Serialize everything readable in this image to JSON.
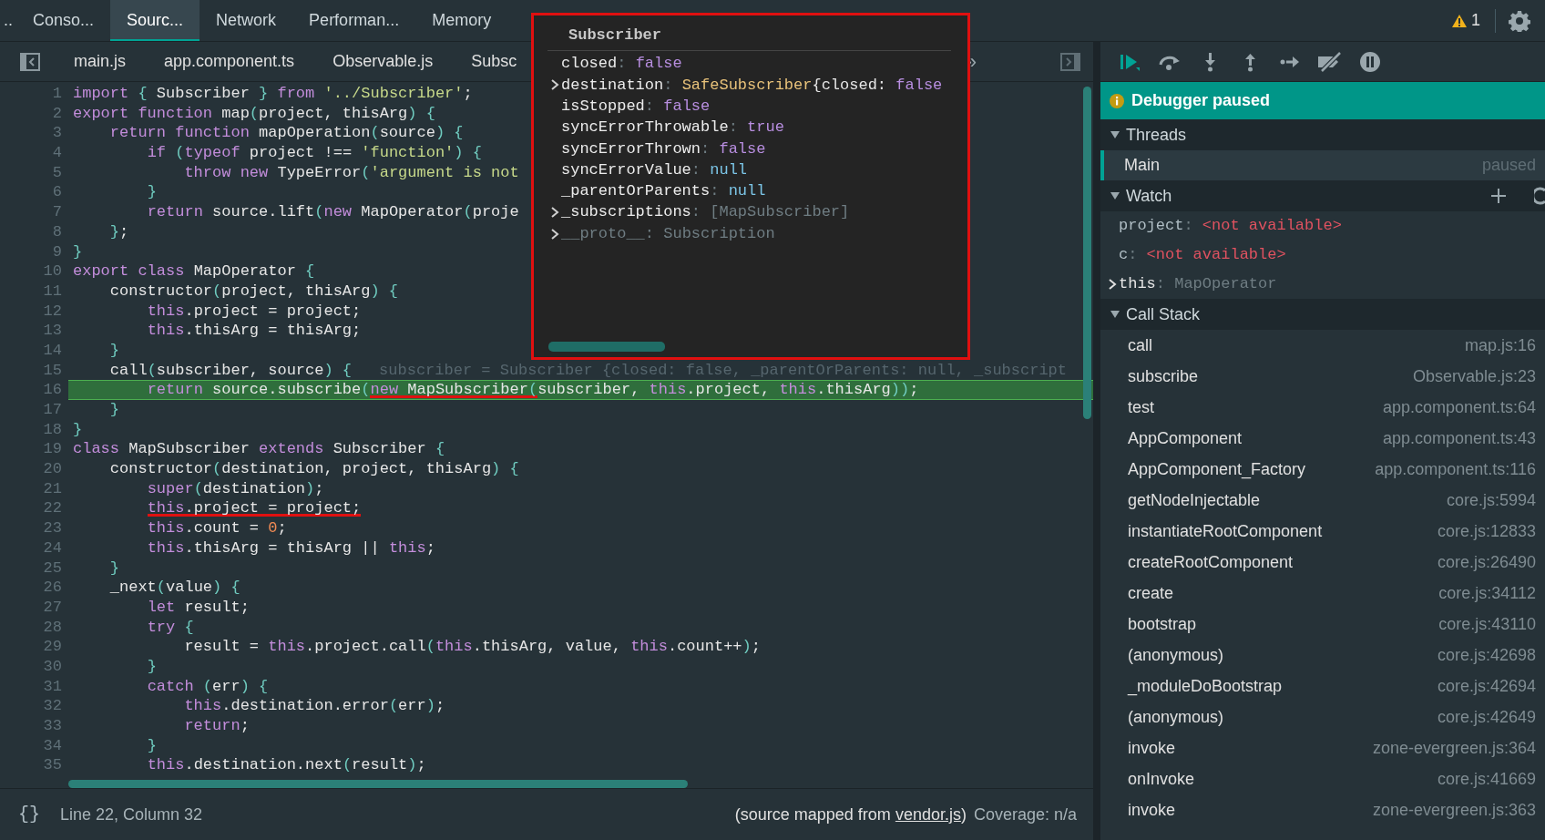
{
  "top_tabs": [
    {
      "label": "..",
      "selected": false
    },
    {
      "label": "Conso...",
      "selected": false
    },
    {
      "label": "Sourc...",
      "selected": true
    },
    {
      "label": "Network",
      "selected": false
    },
    {
      "label": "Performan...",
      "selected": false
    },
    {
      "label": "Memory",
      "selected": false
    }
  ],
  "warnings": "1",
  "file_tabs": [
    {
      "label": "main.js"
    },
    {
      "label": "app.component.ts"
    },
    {
      "label": "Observable.js"
    },
    {
      "label": "Subsc"
    }
  ],
  "file_tabs_more": "»",
  "code": {
    "lines": [
      {
        "number": "1",
        "current": false,
        "tokens": [
          {
            "kind": "keyword",
            "text": "import "
          },
          {
            "kind": "punct",
            "text": "{"
          },
          {
            "kind": "plain",
            "text": " Subscriber "
          },
          {
            "kind": "punct",
            "text": "}"
          },
          {
            "kind": "keyword",
            "text": " from "
          },
          {
            "kind": "string",
            "text": "'../Subscriber'"
          },
          {
            "kind": "plain",
            "text": ";"
          }
        ]
      },
      {
        "number": "2",
        "current": false,
        "tokens": [
          {
            "kind": "keyword",
            "text": "export function "
          },
          {
            "kind": "plain",
            "text": "map"
          },
          {
            "kind": "punct",
            "text": "("
          },
          {
            "kind": "plain",
            "text": "project, thisArg"
          },
          {
            "kind": "punct",
            "text": ") {"
          }
        ]
      },
      {
        "number": "3",
        "current": false,
        "tokens": [
          {
            "kind": "keyword",
            "text": "    return function "
          },
          {
            "kind": "plain",
            "text": "mapOperation"
          },
          {
            "kind": "punct",
            "text": "("
          },
          {
            "kind": "plain",
            "text": "source"
          },
          {
            "kind": "punct",
            "text": ") {"
          }
        ]
      },
      {
        "number": "4",
        "current": false,
        "tokens": [
          {
            "kind": "keyword",
            "text": "        if "
          },
          {
            "kind": "punct",
            "text": "("
          },
          {
            "kind": "keyword",
            "text": "typeof "
          },
          {
            "kind": "plain",
            "text": "project !== "
          },
          {
            "kind": "string",
            "text": "'function'"
          },
          {
            "kind": "punct",
            "text": ") {"
          }
        ]
      },
      {
        "number": "5",
        "current": false,
        "tokens": [
          {
            "kind": "keyword",
            "text": "            throw new "
          },
          {
            "kind": "plain",
            "text": "TypeError"
          },
          {
            "kind": "punct",
            "text": "("
          },
          {
            "kind": "string",
            "text": "'argument is not"
          }
        ]
      },
      {
        "number": "6",
        "current": false,
        "tokens": [
          {
            "kind": "punct",
            "text": "        }"
          }
        ]
      },
      {
        "number": "7",
        "current": false,
        "tokens": [
          {
            "kind": "keyword",
            "text": "        return "
          },
          {
            "kind": "plain",
            "text": "source.lift"
          },
          {
            "kind": "punct",
            "text": "("
          },
          {
            "kind": "keyword",
            "text": "new "
          },
          {
            "kind": "plain",
            "text": "MapOperator"
          },
          {
            "kind": "punct",
            "text": "("
          },
          {
            "kind": "plain",
            "text": "proje"
          }
        ]
      },
      {
        "number": "8",
        "current": false,
        "tokens": [
          {
            "kind": "punct",
            "text": "    }"
          },
          {
            "kind": "plain",
            "text": ";"
          }
        ]
      },
      {
        "number": "9",
        "current": false,
        "tokens": [
          {
            "kind": "punct",
            "text": "}"
          }
        ]
      },
      {
        "number": "10",
        "current": false,
        "tokens": [
          {
            "kind": "keyword",
            "text": "export class "
          },
          {
            "kind": "plain",
            "text": "MapOperator "
          },
          {
            "kind": "punct",
            "text": "{"
          }
        ]
      },
      {
        "number": "11",
        "current": false,
        "tokens": [
          {
            "kind": "plain",
            "text": "    constructor"
          },
          {
            "kind": "punct",
            "text": "("
          },
          {
            "kind": "plain",
            "text": "project, thisArg"
          },
          {
            "kind": "punct",
            "text": ") {"
          }
        ]
      },
      {
        "number": "12",
        "current": false,
        "tokens": [
          {
            "kind": "keyword",
            "text": "        this"
          },
          {
            "kind": "plain",
            "text": ".project = project;"
          }
        ]
      },
      {
        "number": "13",
        "current": false,
        "tokens": [
          {
            "kind": "keyword",
            "text": "        this"
          },
          {
            "kind": "plain",
            "text": ".thisArg = thisArg;"
          }
        ]
      },
      {
        "number": "14",
        "current": false,
        "tokens": [
          {
            "kind": "punct",
            "text": "    }"
          }
        ]
      },
      {
        "number": "15",
        "current": false,
        "inline_value": "subscriber = Subscriber {closed: false, _parentOrParents: null, _subscript",
        "tokens": [
          {
            "kind": "plain",
            "text": "    call"
          },
          {
            "kind": "punct",
            "text": "("
          },
          {
            "kind": "plain",
            "text": "subscriber, source"
          },
          {
            "kind": "punct",
            "text": ") {"
          }
        ]
      },
      {
        "number": "16",
        "current": true,
        "tokens": [
          {
            "kind": "keyword",
            "text": "        return "
          },
          {
            "kind": "plain",
            "text": "source.subscribe"
          },
          {
            "kind": "punct",
            "text": "("
          },
          {
            "kind": "keyword",
            "text": "new ",
            "underlined": true
          },
          {
            "kind": "plain",
            "text": "MapSubscriber",
            "underlined": true
          },
          {
            "kind": "punct",
            "text": "(",
            "underlined": true
          },
          {
            "kind": "plain",
            "text": "subscriber, "
          },
          {
            "kind": "keyword",
            "text": "this"
          },
          {
            "kind": "plain",
            "text": ".project, "
          },
          {
            "kind": "keyword",
            "text": "this"
          },
          {
            "kind": "plain",
            "text": ".thisArg"
          },
          {
            "kind": "punct",
            "text": "))"
          },
          {
            "kind": "plain",
            "text": ";"
          }
        ]
      },
      {
        "number": "17",
        "current": false,
        "tokens": [
          {
            "kind": "punct",
            "text": "    }"
          }
        ]
      },
      {
        "number": "18",
        "current": false,
        "tokens": [
          {
            "kind": "punct",
            "text": "}"
          }
        ]
      },
      {
        "number": "19",
        "current": false,
        "tokens": [
          {
            "kind": "keyword",
            "text": "class "
          },
          {
            "kind": "plain",
            "text": "MapSubscriber "
          },
          {
            "kind": "keyword",
            "text": "extends "
          },
          {
            "kind": "plain",
            "text": "Subscriber "
          },
          {
            "kind": "punct",
            "text": "{"
          }
        ]
      },
      {
        "number": "20",
        "current": false,
        "tokens": [
          {
            "kind": "plain",
            "text": "    constructor"
          },
          {
            "kind": "punct",
            "text": "("
          },
          {
            "kind": "plain",
            "text": "destination, project, thisArg"
          },
          {
            "kind": "punct",
            "text": ") {"
          }
        ]
      },
      {
        "number": "21",
        "current": false,
        "tokens": [
          {
            "kind": "keyword",
            "text": "        super"
          },
          {
            "kind": "punct",
            "text": "("
          },
          {
            "kind": "plain",
            "text": "destination"
          },
          {
            "kind": "punct",
            "text": ")"
          },
          {
            "kind": "plain",
            "text": ";"
          }
        ]
      },
      {
        "number": "22",
        "current": false,
        "tokens": [
          {
            "kind": "keyword",
            "text": "        this",
            "underlined": true
          },
          {
            "kind": "plain",
            "text": ".project = project;",
            "underlined": true
          }
        ]
      },
      {
        "number": "23",
        "current": false,
        "tokens": [
          {
            "kind": "keyword",
            "text": "        this"
          },
          {
            "kind": "plain",
            "text": ".count = "
          },
          {
            "kind": "number",
            "text": "0"
          },
          {
            "kind": "plain",
            "text": ";"
          }
        ]
      },
      {
        "number": "24",
        "current": false,
        "tokens": [
          {
            "kind": "keyword",
            "text": "        this"
          },
          {
            "kind": "plain",
            "text": ".thisArg = thisArg || "
          },
          {
            "kind": "keyword",
            "text": "this"
          },
          {
            "kind": "plain",
            "text": ";"
          }
        ]
      },
      {
        "number": "25",
        "current": false,
        "tokens": [
          {
            "kind": "punct",
            "text": "    }"
          }
        ]
      },
      {
        "number": "26",
        "current": false,
        "tokens": [
          {
            "kind": "plain",
            "text": "    _next"
          },
          {
            "kind": "punct",
            "text": "("
          },
          {
            "kind": "plain",
            "text": "value"
          },
          {
            "kind": "punct",
            "text": ") {"
          }
        ]
      },
      {
        "number": "27",
        "current": false,
        "tokens": [
          {
            "kind": "keyword",
            "text": "        let "
          },
          {
            "kind": "plain",
            "text": "result;"
          }
        ]
      },
      {
        "number": "28",
        "current": false,
        "tokens": [
          {
            "kind": "keyword",
            "text": "        try "
          },
          {
            "kind": "punct",
            "text": "{"
          }
        ]
      },
      {
        "number": "29",
        "current": false,
        "tokens": [
          {
            "kind": "plain",
            "text": "            result = "
          },
          {
            "kind": "keyword",
            "text": "this"
          },
          {
            "kind": "plain",
            "text": ".project.call"
          },
          {
            "kind": "punct",
            "text": "("
          },
          {
            "kind": "keyword",
            "text": "this"
          },
          {
            "kind": "plain",
            "text": ".thisArg, value, "
          },
          {
            "kind": "keyword",
            "text": "this"
          },
          {
            "kind": "plain",
            "text": ".count++"
          },
          {
            "kind": "punct",
            "text": ")"
          },
          {
            "kind": "plain",
            "text": ";"
          }
        ]
      },
      {
        "number": "30",
        "current": false,
        "tokens": [
          {
            "kind": "punct",
            "text": "        }"
          }
        ]
      },
      {
        "number": "31",
        "current": false,
        "tokens": [
          {
            "kind": "keyword",
            "text": "        catch "
          },
          {
            "kind": "punct",
            "text": "("
          },
          {
            "kind": "plain",
            "text": "err"
          },
          {
            "kind": "punct",
            "text": ") {"
          }
        ]
      },
      {
        "number": "32",
        "current": false,
        "tokens": [
          {
            "kind": "keyword",
            "text": "            this"
          },
          {
            "kind": "plain",
            "text": ".destination.error"
          },
          {
            "kind": "punct",
            "text": "("
          },
          {
            "kind": "plain",
            "text": "err"
          },
          {
            "kind": "punct",
            "text": ")"
          },
          {
            "kind": "plain",
            "text": ";"
          }
        ]
      },
      {
        "number": "33",
        "current": false,
        "tokens": [
          {
            "kind": "keyword",
            "text": "            return"
          },
          {
            "kind": "plain",
            "text": ";"
          }
        ]
      },
      {
        "number": "34",
        "current": false,
        "tokens": [
          {
            "kind": "punct",
            "text": "        }"
          }
        ]
      },
      {
        "number": "35",
        "current": false,
        "tokens": [
          {
            "kind": "keyword",
            "text": "        this"
          },
          {
            "kind": "plain",
            "text": ".destination.next"
          },
          {
            "kind": "punct",
            "text": "("
          },
          {
            "kind": "plain",
            "text": "result"
          },
          {
            "kind": "punct",
            "text": ")"
          },
          {
            "kind": "plain",
            "text": ";"
          }
        ]
      }
    ]
  },
  "status_bar": {
    "pretty_print": "{}",
    "position": "Line 22, Column 32",
    "source_prefix": "(source mapped from ",
    "source_link": "vendor.js",
    "source_suffix": ")",
    "coverage": "Coverage: n/a"
  },
  "popup": {
    "title": "Subscriber",
    "properties": [
      {
        "name": "closed",
        "expandable": false,
        "inherited": false,
        "value": [
          {
            "kind": "dim",
            "text": ": "
          },
          {
            "kind": "bool",
            "text": "false"
          }
        ]
      },
      {
        "name": "destination",
        "expandable": true,
        "inherited": false,
        "value": [
          {
            "kind": "dim",
            "text": ": "
          },
          {
            "kind": "class",
            "text": "SafeSubscriber"
          },
          {
            "kind": "plain",
            "text": " {closed: "
          },
          {
            "kind": "bool",
            "text": "false"
          }
        ]
      },
      {
        "name": "isStopped",
        "expandable": false,
        "inherited": false,
        "value": [
          {
            "kind": "dim",
            "text": ": "
          },
          {
            "kind": "bool",
            "text": "false"
          }
        ]
      },
      {
        "name": "syncErrorThrowable",
        "expandable": false,
        "inherited": false,
        "value": [
          {
            "kind": "dim",
            "text": ": "
          },
          {
            "kind": "bool",
            "text": "true"
          }
        ]
      },
      {
        "name": "syncErrorThrown",
        "expandable": false,
        "inherited": false,
        "value": [
          {
            "kind": "dim",
            "text": ": "
          },
          {
            "kind": "bool",
            "text": "false"
          }
        ]
      },
      {
        "name": "syncErrorValue",
        "expandable": false,
        "inherited": false,
        "value": [
          {
            "kind": "dim",
            "text": ": "
          },
          {
            "kind": "null",
            "text": "null"
          }
        ]
      },
      {
        "name": "_parentOrParents",
        "expandable": false,
        "inherited": false,
        "value": [
          {
            "kind": "dim",
            "text": ": "
          },
          {
            "kind": "null",
            "text": "null"
          }
        ]
      },
      {
        "name": "_subscriptions",
        "expandable": true,
        "inherited": false,
        "value": [
          {
            "kind": "dim",
            "text": ": [MapSubscriber]"
          }
        ]
      },
      {
        "name": "__proto__",
        "expandable": true,
        "inherited": true,
        "value": [
          {
            "kind": "dim",
            "text": ": Subscription"
          }
        ]
      }
    ]
  },
  "debugger": {
    "banner": "Debugger paused",
    "sections": [
      {
        "kind": "threads",
        "title": "Threads",
        "expanded": true,
        "threads": [
          {
            "name": "Main",
            "state": "paused",
            "selected": true
          }
        ]
      },
      {
        "kind": "watch",
        "title": "Watch",
        "expanded": true,
        "items": [
          {
            "name": "project",
            "expandable": false,
            "value": [
              {
                "kind": "dim",
                "text": ": "
              },
              {
                "kind": "error",
                "text": "<not available>"
              }
            ]
          },
          {
            "name": "c",
            "expandable": false,
            "value": [
              {
                "kind": "dim",
                "text": ": "
              },
              {
                "kind": "error",
                "text": "<not available>"
              }
            ]
          },
          {
            "name": "this",
            "expandable": true,
            "value": [
              {
                "kind": "dim",
                "text": ": MapOperator"
              }
            ]
          }
        ]
      },
      {
        "kind": "callstack",
        "title": "Call Stack",
        "expanded": true,
        "frames": [
          {
            "name": "call",
            "location": "map.js:16"
          },
          {
            "name": "subscribe",
            "location": "Observable.js:23"
          },
          {
            "name": "test",
            "location": "app.component.ts:64"
          },
          {
            "name": "AppComponent",
            "location": "app.component.ts:43"
          },
          {
            "name": "AppComponent_Factory",
            "location": "app.component.ts:116"
          },
          {
            "name": "getNodeInjectable",
            "location": "core.js:5994"
          },
          {
            "name": "instantiateRootComponent",
            "location": "core.js:12833"
          },
          {
            "name": "createRootComponent",
            "location": "core.js:26490"
          },
          {
            "name": "create",
            "location": "core.js:34112"
          },
          {
            "name": "bootstrap",
            "location": "core.js:43110"
          },
          {
            "name": "(anonymous)",
            "location": "core.js:42698"
          },
          {
            "name": "_moduleDoBootstrap",
            "location": "core.js:42694"
          },
          {
            "name": "(anonymous)",
            "location": "core.js:42649"
          },
          {
            "name": "invoke",
            "location": "zone-evergreen.js:364"
          },
          {
            "name": "onInvoke",
            "location": "core.js:41669"
          },
          {
            "name": "invoke",
            "location": "zone-evergreen.js:363"
          }
        ]
      }
    ]
  }
}
